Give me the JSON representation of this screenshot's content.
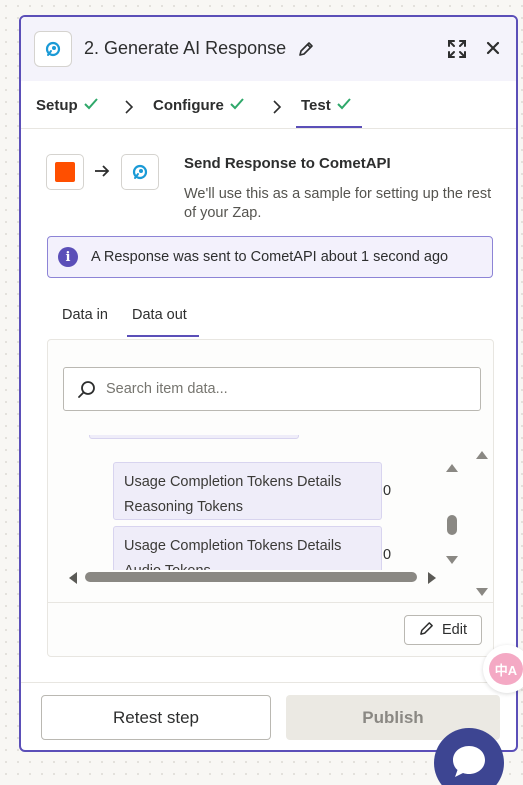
{
  "header": {
    "title": "2. Generate AI Response"
  },
  "steps": [
    {
      "label": "Setup",
      "complete": true
    },
    {
      "label": "Configure",
      "complete": true
    },
    {
      "label": "Test",
      "complete": true,
      "active": true
    }
  ],
  "flow": {
    "title": "Send Response to CometAPI",
    "description": "We'll use this as a sample for setting up the rest of your Zap."
  },
  "info": {
    "message": "A Response was sent to CometAPI about 1 second ago"
  },
  "tabs": [
    {
      "label": "Data in",
      "active": false
    },
    {
      "label": "Data out",
      "active": true
    }
  ],
  "search": {
    "placeholder": "Search item data..."
  },
  "data_items": [
    {
      "key": "Usage Completion Tokens Details Reasoning Tokens",
      "value": "0"
    },
    {
      "key": "Usage Completion Tokens Details Audio Tokens",
      "value": "0"
    }
  ],
  "actions": {
    "edit_label": "Edit",
    "retest_label": "Retest step",
    "publish_label": "Publish"
  },
  "translate_badge": "中A",
  "colors": {
    "accent": "#5b4fb8",
    "brand_orange": "#ff4f00",
    "success": "#2fa86a",
    "chat_fab": "#3d4592"
  }
}
